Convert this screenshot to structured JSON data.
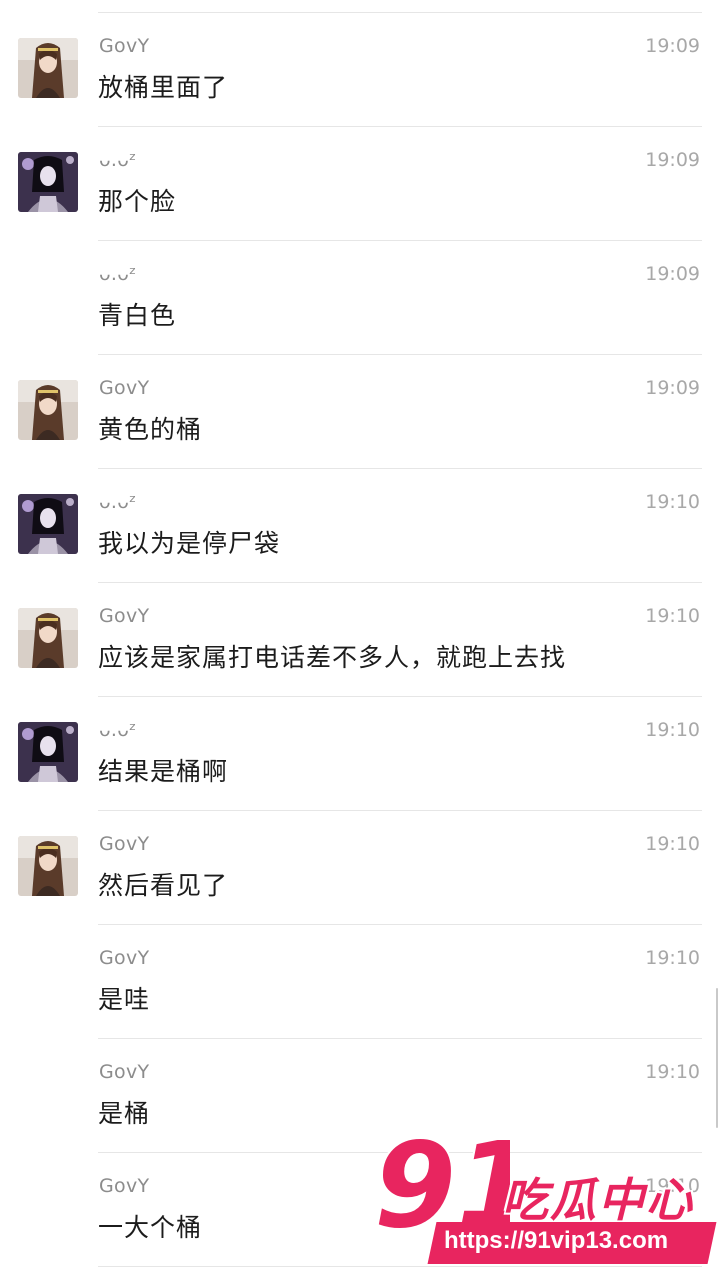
{
  "colors": {
    "sender": "#8c8c8c",
    "time": "#a8a8a8",
    "text": "#1c1c1c",
    "divider": "#e6e6e6",
    "watermark": "#e8255f"
  },
  "messages": [
    {
      "sender": "GovY",
      "time": "19:09",
      "text": "放桶里面了",
      "avatar": "govy-avatar"
    },
    {
      "sender": "ᴗ.ᴗᶻ",
      "time": "19:09",
      "text": "那个脸",
      "avatar": "uuz-avatar"
    },
    {
      "sender": "ᴗ.ᴗᶻ",
      "time": "19:09",
      "text": "青白色",
      "avatar": null
    },
    {
      "sender": "GovY",
      "time": "19:09",
      "text": "黄色的桶",
      "avatar": "govy-avatar"
    },
    {
      "sender": "ᴗ.ᴗᶻ",
      "time": "19:10",
      "text": "我以为是停尸袋",
      "avatar": "uuz-avatar"
    },
    {
      "sender": "GovY",
      "time": "19:10",
      "text": "应该是家属打电话差不多人，就跑上去找",
      "avatar": "govy-avatar"
    },
    {
      "sender": "ᴗ.ᴗᶻ",
      "time": "19:10",
      "text": "结果是桶啊",
      "avatar": "uuz-avatar"
    },
    {
      "sender": "GovY",
      "time": "19:10",
      "text": "然后看见了",
      "avatar": "govy-avatar"
    },
    {
      "sender": "GovY",
      "time": "19:10",
      "text": "是哇",
      "avatar": null
    },
    {
      "sender": "GovY",
      "time": "19:10",
      "text": "是桶",
      "avatar": null
    },
    {
      "sender": "GovY",
      "time": "19:10",
      "text": "一大个桶",
      "avatar": null
    }
  ],
  "watermark": {
    "logo": "91",
    "brand": "吃瓜中心",
    "url": "https://91vip13.com"
  }
}
